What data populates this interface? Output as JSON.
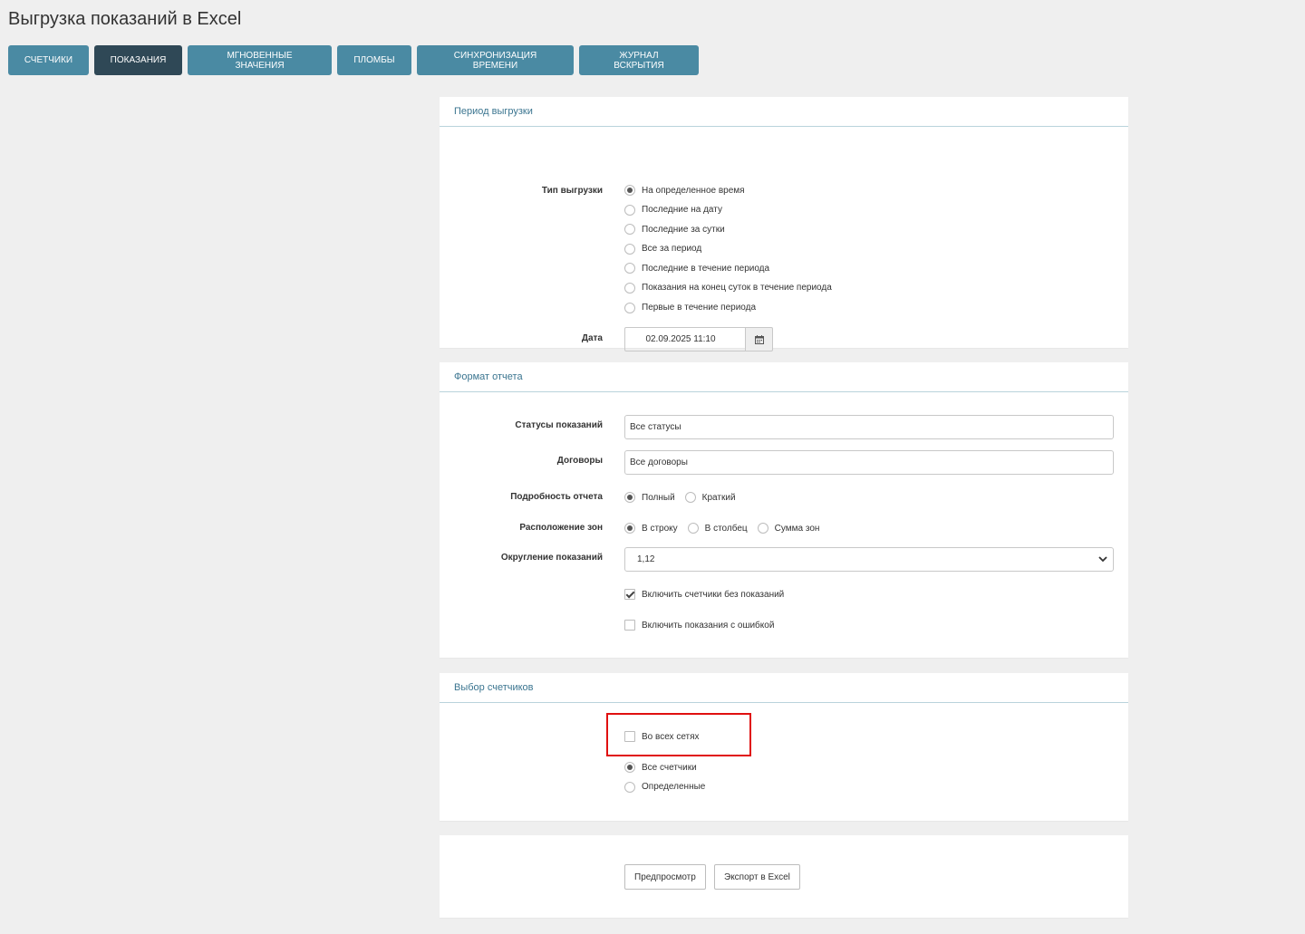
{
  "page_title": "Выгрузка показаний в Excel",
  "tabs": [
    {
      "label": "СЧЕТЧИКИ",
      "active": false
    },
    {
      "label": "ПОКАЗАНИЯ",
      "active": true
    },
    {
      "label": "МГНОВЕННЫЕ ЗНАЧЕНИЯ",
      "active": false
    },
    {
      "label": "ПЛОМБЫ",
      "active": false
    },
    {
      "label": "СИНХРОНИЗАЦИЯ ВРЕМЕНИ",
      "active": false
    },
    {
      "label": "ЖУРНАЛ ВСКРЫТИЯ",
      "active": false
    }
  ],
  "period": {
    "title": "Период выгрузки",
    "type_label": "Тип выгрузки",
    "type_options": [
      {
        "label": "На определенное время",
        "selected": true
      },
      {
        "label": "Последние на дату",
        "selected": false
      },
      {
        "label": "Последние за сутки",
        "selected": false
      },
      {
        "label": "Все за период",
        "selected": false
      },
      {
        "label": "Последние в течение периода",
        "selected": false
      },
      {
        "label": "Показания на конец суток в течение периода",
        "selected": false
      },
      {
        "label": "Первые в течение периода",
        "selected": false
      }
    ],
    "date_label": "Дата",
    "date_value": "02.09.2025 11:10"
  },
  "format": {
    "title": "Формат отчета",
    "statuses_label": "Статусы показаний",
    "statuses_value": "Все статусы",
    "contracts_label": "Договоры",
    "contracts_value": "Все договоры",
    "detail_label": "Подробность отчета",
    "detail_options": [
      {
        "label": "Полный",
        "selected": true
      },
      {
        "label": "Краткий",
        "selected": false
      }
    ],
    "zones_label": "Расположение зон",
    "zones_options": [
      {
        "label": "В строку",
        "selected": true
      },
      {
        "label": "В столбец",
        "selected": false
      },
      {
        "label": "Сумма зон",
        "selected": false
      }
    ],
    "rounding_label": "Округление показаний",
    "rounding_value": "1,12",
    "include_no_readings": {
      "label": "Включить счетчики без показаний",
      "checked": true
    },
    "include_errors": {
      "label": "Включить показания с ошибкой",
      "checked": false
    }
  },
  "meters": {
    "title": "Выбор счетчиков",
    "all_networks": {
      "label": "Во всех сетях",
      "checked": false
    },
    "options": [
      {
        "label": "Все счетчики",
        "selected": true
      },
      {
        "label": "Определенные",
        "selected": false
      }
    ]
  },
  "actions": {
    "preview_label": "Предпросмотр",
    "export_label": "Экспорт в Excel"
  },
  "colors": {
    "tab": "#4a8aa3",
    "tab_active": "#2f4856",
    "panel_title": "#3b7590",
    "highlight": "#e01010"
  }
}
